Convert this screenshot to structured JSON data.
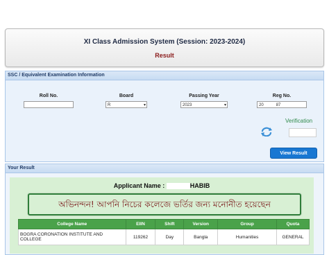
{
  "header": {
    "title": "XI Class Admission System (Session: 2023-2024)",
    "subtitle": "Result"
  },
  "ssc": {
    "heading": "SSC / Equivalent Examination Information",
    "roll": {
      "label": "Roll No.",
      "value": ""
    },
    "board": {
      "label": "Board",
      "value": "R"
    },
    "passing_year": {
      "label": "Passing Year",
      "value": "2023"
    },
    "reg": {
      "label": "Reg No.",
      "value_prefix": "20",
      "value_suffix": "87"
    },
    "verification_label": "Verification",
    "view_button": "View Result"
  },
  "result": {
    "heading": "Your Result",
    "applicant_label": "Applicant Name :",
    "applicant_name": "HABIB",
    "congrats": "অভিনন্দন! আপনি নিচের কলেজে ভর্তির জন্য মনোনীত হয়েছেন",
    "columns": [
      "College Name",
      "EIIN",
      "Shift",
      "Version",
      "Group",
      "Quota"
    ],
    "row": {
      "college": "BOGRA CORONATION INSTITUTE AND COLLEGE",
      "eiin": "119262",
      "shift": "Day",
      "version": "Bangla",
      "group": "Humanities",
      "quota": "GENERAL"
    }
  },
  "colors": {
    "button": "#1877d2",
    "table_header": "#4aa24a",
    "result_bg": "#d8f0d4",
    "subtitle": "#8a1a1a"
  }
}
